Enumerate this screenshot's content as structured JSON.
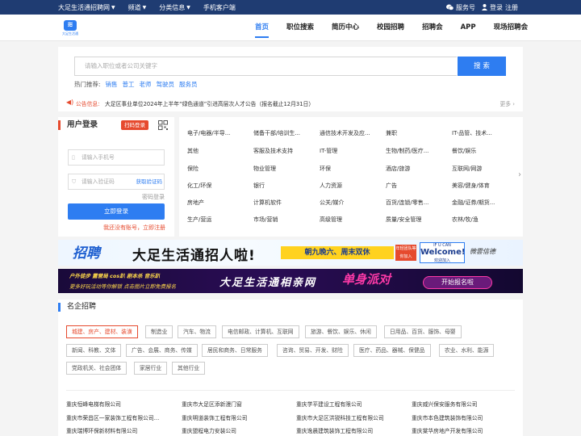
{
  "topbar": {
    "site_name": "大足生活通招聘网",
    "channel": "频道",
    "classified": "分类信息",
    "mobile": "手机客户端",
    "service": "服务号",
    "login": "登录",
    "register": "注册"
  },
  "header": {
    "logo_text": "大足生活通",
    "nav": [
      "首页",
      "职位搜索",
      "简历中心",
      "校园招聘",
      "招聘会",
      "APP",
      "现场招聘会"
    ]
  },
  "search": {
    "placeholder": "请输入职位或者公司关键字",
    "button": "搜 索",
    "hot_label": "热门推荐:",
    "hot_keywords": [
      "销售",
      "普工",
      "老师",
      "驾驶员",
      "服务员"
    ]
  },
  "notice": {
    "label": "公告信息:",
    "text": "大足区事业单位2024年上半年“绿色通道”引进高层次人才公告（报名截止12月31日）",
    "more": "更多 ›"
  },
  "login": {
    "title": "用户登录",
    "scan": "扫码登录",
    "phone_placeholder": "请输入手机号",
    "code_placeholder": "请输入验证码",
    "get_code": "获取验证码",
    "password_login": "密码登录",
    "submit": "立即登录",
    "no_account": "我还没有账号，立即注册"
  },
  "categories": [
    [
      "电子/电器/半导...",
      "储备干部/培训生...",
      "通信技术开发及应...",
      "兼职",
      "IT-品管、技术..."
    ],
    [
      "其他",
      "客服及技术支持",
      "IT-管理",
      "生物/制药/医疗...",
      "餐饮/娱乐"
    ],
    [
      "保险",
      "物业管理",
      "环保",
      "酒店/旅游",
      "互联网/网游"
    ],
    [
      "化工/环保",
      "银行",
      "人力资源",
      "广告",
      "美容/健身/体育"
    ],
    [
      "房地产",
      "计算机软件",
      "公关/媒介",
      "百货/连锁/零售...",
      "金融/证券/期货..."
    ],
    [
      "生产/营运",
      "市场/营销",
      "高级管理",
      "质量/安全管理",
      "农林/牧/渔"
    ]
  ],
  "banner1": {
    "logo": "招聘",
    "headline": "大足生活通招人啦!",
    "schedule": "朝九晚六、周末双休",
    "join": "年轻团队等你加入",
    "welcome_top": "IF U CAN",
    "welcome": "Welcome!",
    "welcome_sub": "欢迎加入",
    "brand": "微雲信德"
  },
  "banner2": {
    "line1": "户外徒步 露营局 cos趴 剧本杀 音乐趴",
    "line2": "更多好玩活动等你解锁 点击图片立即免费报名",
    "title": "大足生活通相亲网",
    "single": "单身派对",
    "cta": "开始报名啦"
  },
  "famous": {
    "title": "名企招聘",
    "tags": [
      "城建、房产、建材、装潢",
      "制造业",
      "汽车、物流",
      "电信邮政、计算机、互联网",
      "旅游、餐饮、娱乐、休闲",
      "日用品、百货、服饰、母婴",
      "新闻、科教、文体",
      "广告、会展、商务、传媒",
      "居民和商务、日常服务",
      "咨询、贸易、开发、财险",
      "医疗、药品、器械、保健品",
      "农业、水利、能源",
      "党政机关、社会团体",
      "家居行业",
      "其他行业"
    ],
    "companies": [
      [
        "重庆恒峰电梯有限公司",
        "重庆市大足区添新漫门窗",
        "重庆学平建设工程有限公司",
        "重庆威兴保安服务有限公司"
      ],
      [
        "重庆市荣昌区一家装饰工程有限公司...",
        "重庆明道装饰工程有限公司",
        "重庆市大足区洪锐科技工程有限公司",
        "重庆市本色建筑装饰有限公司"
      ],
      [
        "重庆瑞博环保新材料有限公司",
        "重庆盟程电力安装公司",
        "重庆逸晨建筑装饰工程有限公司",
        "重庆棠华房地产开发有限公司"
      ]
    ]
  }
}
